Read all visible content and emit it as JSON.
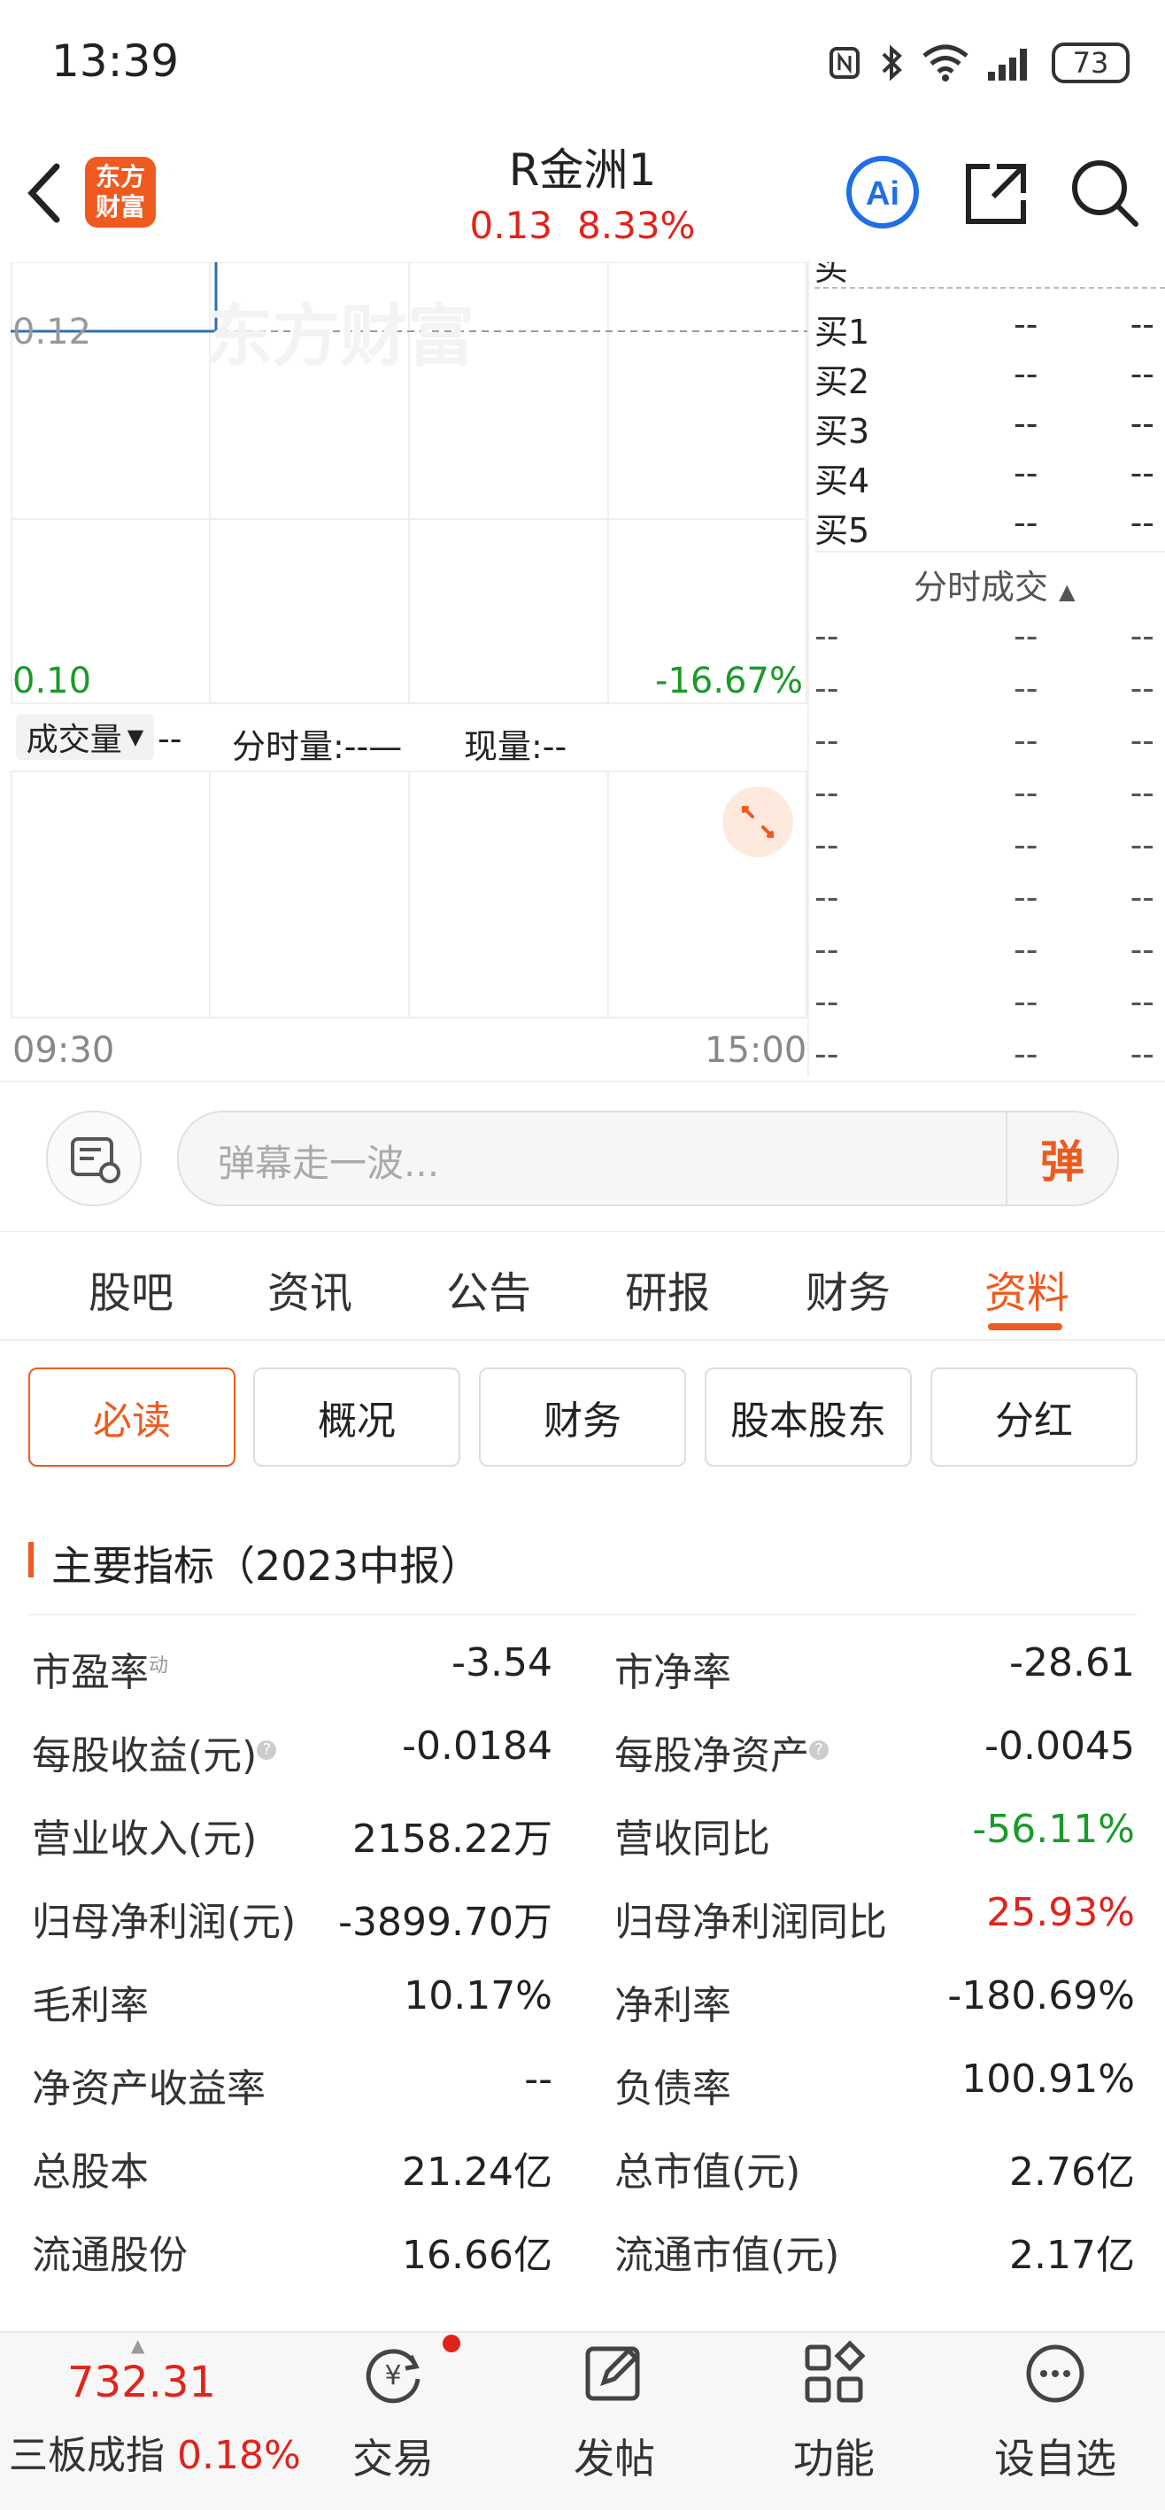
{
  "status_bar": {
    "time": "13:39",
    "battery": "73"
  },
  "header": {
    "logo_lines": [
      "东方",
      "财富"
    ],
    "title": "R金洲1",
    "price": "0.13",
    "change_pct": "8.33%"
  },
  "chart": {
    "watermark": "东方财富",
    "upper_price": "0.12",
    "lower_price": "0.10",
    "lower_pct": "-16.67%",
    "volume_label": "成交量",
    "volume_value": "--",
    "per_minute_label": "分时量:--—",
    "current_label": "现量:--",
    "time_start": "09:30",
    "time_end": "15:00",
    "colors": {
      "line": "#2f6fb0",
      "up": "#e2231a",
      "down": "#1a9a2a"
    }
  },
  "order_book": {
    "buy_rows": [
      {
        "label": "买1",
        "price": "--",
        "vol": "--"
      },
      {
        "label": "买2",
        "price": "--",
        "vol": "--"
      },
      {
        "label": "买3",
        "price": "--",
        "vol": "--"
      },
      {
        "label": "买4",
        "price": "--",
        "vol": "--"
      },
      {
        "label": "买5",
        "price": "--",
        "vol": "--"
      }
    ],
    "ticks_title": "分时成交",
    "tick_rows": [
      {
        "t": "--",
        "p": "--",
        "v": "--"
      },
      {
        "t": "--",
        "p": "--",
        "v": "--"
      },
      {
        "t": "--",
        "p": "--",
        "v": "--"
      },
      {
        "t": "--",
        "p": "--",
        "v": "--"
      },
      {
        "t": "--",
        "p": "--",
        "v": "--"
      },
      {
        "t": "--",
        "p": "--",
        "v": "--"
      },
      {
        "t": "--",
        "p": "--",
        "v": "--"
      },
      {
        "t": "--",
        "p": "--",
        "v": "--"
      },
      {
        "t": "--",
        "p": "--",
        "v": "--"
      }
    ]
  },
  "comment": {
    "placeholder": "弹幕走一波...",
    "button": "弹"
  },
  "tabs": [
    "股吧",
    "资讯",
    "公告",
    "研报",
    "财务",
    "资料"
  ],
  "subtabs": [
    "必读",
    "概况",
    "财务",
    "股本股东",
    "分红"
  ],
  "section_title": "主要指标（2023中报）",
  "metrics": [
    {
      "left_label": "市盈率",
      "left_sup": "动",
      "left_value": "-3.54",
      "right_label": "市净率",
      "right_value": "-28.61",
      "right_color": ""
    },
    {
      "left_label": "每股收益(元)",
      "left_q": "?",
      "left_value": "-0.0184",
      "right_label": "每股净资产",
      "right_q": "?",
      "right_value": "-0.0045",
      "right_color": ""
    },
    {
      "left_label": "营业收入(元)",
      "left_value": "2158.22万",
      "right_label": "营收同比",
      "right_value": "-56.11%",
      "right_color": "green"
    },
    {
      "left_label": "归母净利润(元)",
      "left_value": "-3899.70万",
      "right_label": "归母净利润同比",
      "right_value": "25.93%",
      "right_color": "red"
    },
    {
      "left_label": "毛利率",
      "left_value": "10.17%",
      "right_label": "净利率",
      "right_value": "-180.69%",
      "right_color": ""
    },
    {
      "left_label": "净资产收益率",
      "left_value": "--",
      "right_label": "负债率",
      "right_value": "100.91%",
      "right_color": ""
    },
    {
      "left_label": "总股本",
      "left_value": "21.24亿",
      "right_label": "总市值(元)",
      "right_value": "2.76亿",
      "right_color": ""
    },
    {
      "left_label": "流通股份",
      "left_value": "16.66亿",
      "right_label": "流通市值(元)",
      "right_value": "2.17亿",
      "right_color": ""
    }
  ],
  "bottom_nav": {
    "index_value": "732.31",
    "index_name": "三板成指",
    "index_pct": "0.18%",
    "items": [
      "交易",
      "发帖",
      "功能",
      "设自选"
    ]
  }
}
